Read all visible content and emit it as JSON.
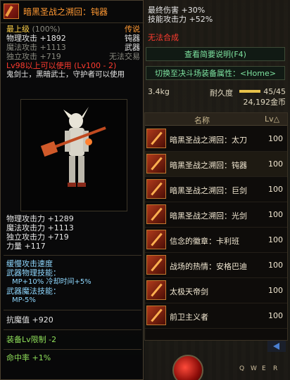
{
  "tooltip": {
    "item_name": "暗黑圣战之溯回：钝器",
    "grade_label": "最上级",
    "grade_pct": "(100%)",
    "rarity": "传说",
    "stat_rows": [
      {
        "label": "物理攻击 +1892",
        "right": "钝器"
      },
      {
        "label": "魔法攻击 +1113",
        "right": "武器"
      },
      {
        "label": "独立攻击 +719",
        "right": "无法交易"
      }
    ],
    "level_req": "Lv98以上可以使用 (Lv100 - 2)",
    "classes": "鬼剑士，黑暗武士，守护者可以使用",
    "bottom_stats": [
      "物理攻击力 +1289",
      "魔法攻击力 +1113",
      "独立攻击力 +719",
      "力量 +117"
    ],
    "skill_header": "缓慢攻击速度",
    "phys_skill_label": "武器物理技能：",
    "phys_skill_value": "MP+10% 冷却时间+5%",
    "mag_skill_label": "武器魔法技能：",
    "mag_skill_value": "MP-5%",
    "anti_magic": "抗魔值 +920",
    "equip_level_limit": "装备Lv限制 -2",
    "hit_rate": "命中率 +1%"
  },
  "hud": {
    "final_damage": "最终伤害 +30%",
    "skill_attack": "技能攻击力 +52%",
    "cannot_synthesize": "无法合成",
    "brief_desc_button": "查看简要说明(F4)",
    "switch_attr_button": "切换至决斗场装备属性：<Home>",
    "weight": "3.4kg",
    "durability_label": "耐久度",
    "durability_value": "45/45",
    "durability_fraction": 1.0,
    "gold": "24,192金币"
  },
  "list": {
    "header_name": "名称",
    "header_lv": "Lv△",
    "items": [
      {
        "name": "暗黑圣战之溯回：太刀",
        "lv": "100",
        "selected": false
      },
      {
        "name": "暗黑圣战之溯回：钝器",
        "lv": "100",
        "selected": true
      },
      {
        "name": "暗黑圣战之溯回：巨剑",
        "lv": "100",
        "selected": false
      },
      {
        "name": "暗黑圣战之溯回：光剑",
        "lv": "100",
        "selected": false
      },
      {
        "name": "信念的徽章：卡利班",
        "lv": "100",
        "selected": false
      },
      {
        "name": "战场的热情：安格巴迪",
        "lv": "100",
        "selected": false
      },
      {
        "name": "太极天帝剑",
        "lv": "100",
        "selected": false
      },
      {
        "name": "前卫主义者",
        "lv": "100",
        "selected": false
      }
    ]
  },
  "hotkeys": [
    "Q",
    "W",
    "E",
    "R"
  ],
  "colors": {
    "item_name": "#ff9933",
    "level_req": "#ff3b2f",
    "accent_green": "#7ee3a0"
  }
}
